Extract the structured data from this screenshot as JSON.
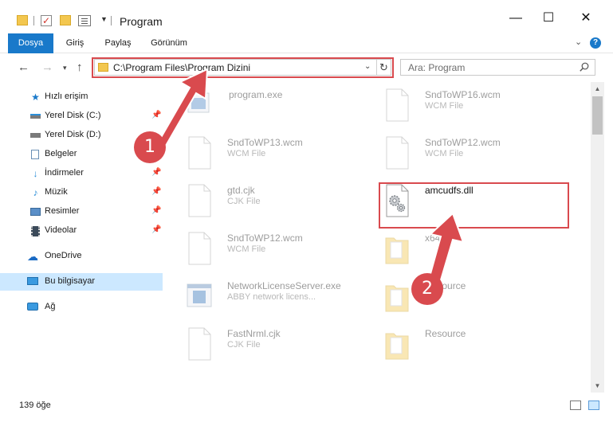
{
  "window": {
    "title": "Program",
    "minimize": "—",
    "maximize": "☐",
    "close": "✕"
  },
  "ribbon": {
    "tabs": [
      "Dosya",
      "Giriş",
      "Paylaş",
      "Görünüm"
    ],
    "help": "?"
  },
  "nav": {
    "address": "C:\\Program Files\\Program Dizini",
    "search_placeholder": "Ara: Program"
  },
  "sidebar": {
    "items": [
      {
        "label": "Hızlı erişim",
        "icon": "star-icon"
      },
      {
        "label": "Yerel Disk (C:)",
        "icon": "drive-icon"
      },
      {
        "label": "Yerel Disk (D:)",
        "icon": "drive-icon"
      },
      {
        "label": "Belgeler",
        "icon": "documents-icon"
      },
      {
        "label": "İndirmeler",
        "icon": "download-icon"
      },
      {
        "label": "Müzik",
        "icon": "music-icon"
      },
      {
        "label": "Resimler",
        "icon": "pictures-icon"
      },
      {
        "label": "Videolar",
        "icon": "video-icon"
      },
      {
        "label": "OneDrive",
        "icon": "cloud-icon"
      },
      {
        "label": "Bu bilgisayar",
        "icon": "computer-icon"
      },
      {
        "label": "Ağ",
        "icon": "network-icon"
      }
    ]
  },
  "files": [
    {
      "name": "program.exe",
      "type": ""
    },
    {
      "name": "SndToWP16.wcm",
      "type": "WCM File"
    },
    {
      "name": "SndToWP13.wcm",
      "type": "WCM File"
    },
    {
      "name": "SndToWP12.wcm",
      "type": "WCM File"
    },
    {
      "name": "gtd.cjk",
      "type": "CJK File"
    },
    {
      "name": "amcudfs.dll",
      "type": ""
    },
    {
      "name": "SndToWP12.wcm",
      "type": "WCM File"
    },
    {
      "name": "x64",
      "type": ""
    },
    {
      "name": "NetworkLicenseServer.exe",
      "type": "ABBY network licens..."
    },
    {
      "name": "Resource",
      "type": ""
    },
    {
      "name": "FastNrml.cjk",
      "type": "CJK File"
    },
    {
      "name": "Resource",
      "type": ""
    }
  ],
  "status": {
    "count": "139 öğe"
  },
  "callouts": {
    "one": "1",
    "two": "2"
  },
  "colors": {
    "accent": "#1979ca",
    "highlight": "#d94a4e",
    "selected": "#cce8ff"
  }
}
